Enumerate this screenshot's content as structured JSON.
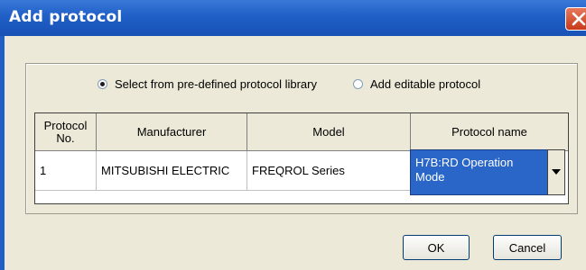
{
  "window": {
    "title": "Add protocol"
  },
  "radio": {
    "predefined_label": "Select from pre-defined protocol library",
    "editable_label": "Add editable protocol",
    "selected": "predefined"
  },
  "table": {
    "headers": [
      "Protocol\nNo.",
      "Manufacturer",
      "Model",
      "Protocol name"
    ],
    "rows": [
      {
        "no": "1",
        "manufacturer": "MITSUBISHI ELECTRIC",
        "model": "FREQROL Series",
        "protocol_name": "H7B:RD Operation Mode"
      }
    ]
  },
  "buttons": {
    "ok": "OK",
    "cancel": "Cancel"
  },
  "colors": {
    "titlebar": "#1f5fc6",
    "selection": "#2a66c8",
    "dialog_bg": "#ece9d8"
  }
}
